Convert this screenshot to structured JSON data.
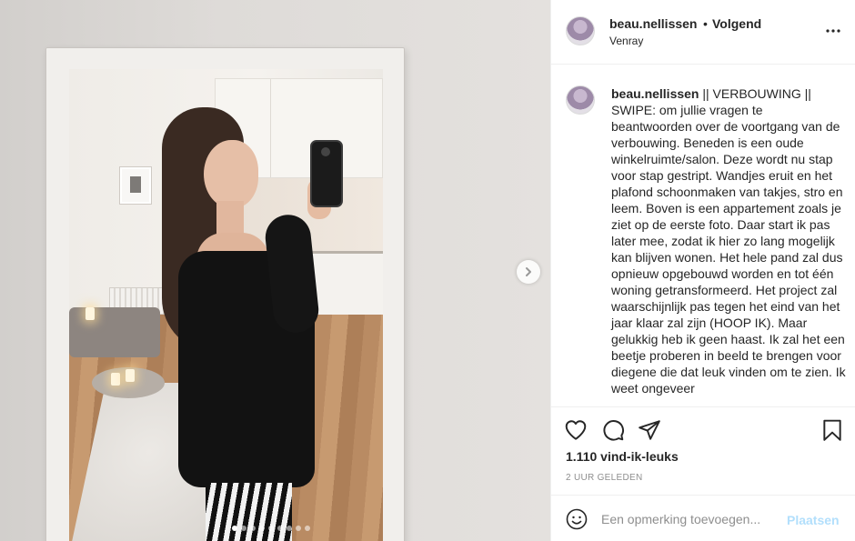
{
  "header": {
    "username": "beau.nellissen",
    "separator": "•",
    "follow_status": "Volgend",
    "location": "Venray",
    "more_icon": "more-horizontal-icon"
  },
  "caption": {
    "username": "beau.nellissen",
    "text": " || VERBOUWING || SWIPE: om jullie vragen te beantwoorden over de voortgang van de verbouwing. Beneden is een oude winkelruimte/salon. Deze wordt nu stap voor stap gestript. Wandjes eruit en het plafond schoonmaken van takjes, stro en leem. Boven is een appartement zoals je ziet op de eerste foto. Daar start ik pas later mee, zodat ik hier zo lang mogelijk kan blijven wonen. Het hele pand zal dus opnieuw opgebouwd worden en tot één woning getransformeerd. Het project zal waarschijnlijk pas tegen het eind van het jaar klaar zal zijn (HOOP IK). Maar gelukkig heb ik geen haast. Ik zal het een beetje proberen in beeld te brengen voor diegene die dat leuk vinden om te zien. Ik weet ongeveer"
  },
  "actions": {
    "icons": [
      "heart-icon",
      "comment-icon",
      "share-icon",
      "bookmark-icon"
    ]
  },
  "likes_text": "1.110 vind-ik-leuks",
  "timestamp": "2 UUR GELEDEN",
  "comment": {
    "placeholder": "Een opmerking toevoegen...",
    "post_label": "Plaatsen",
    "emoji_icon": "emoji-icon"
  },
  "carousel": {
    "slide_count": 9,
    "active_slide": 1
  },
  "colors": {
    "text": "#262626",
    "secondary": "#8e8e8e",
    "post_disabled": "#b2dffc",
    "border": "#efefef"
  }
}
